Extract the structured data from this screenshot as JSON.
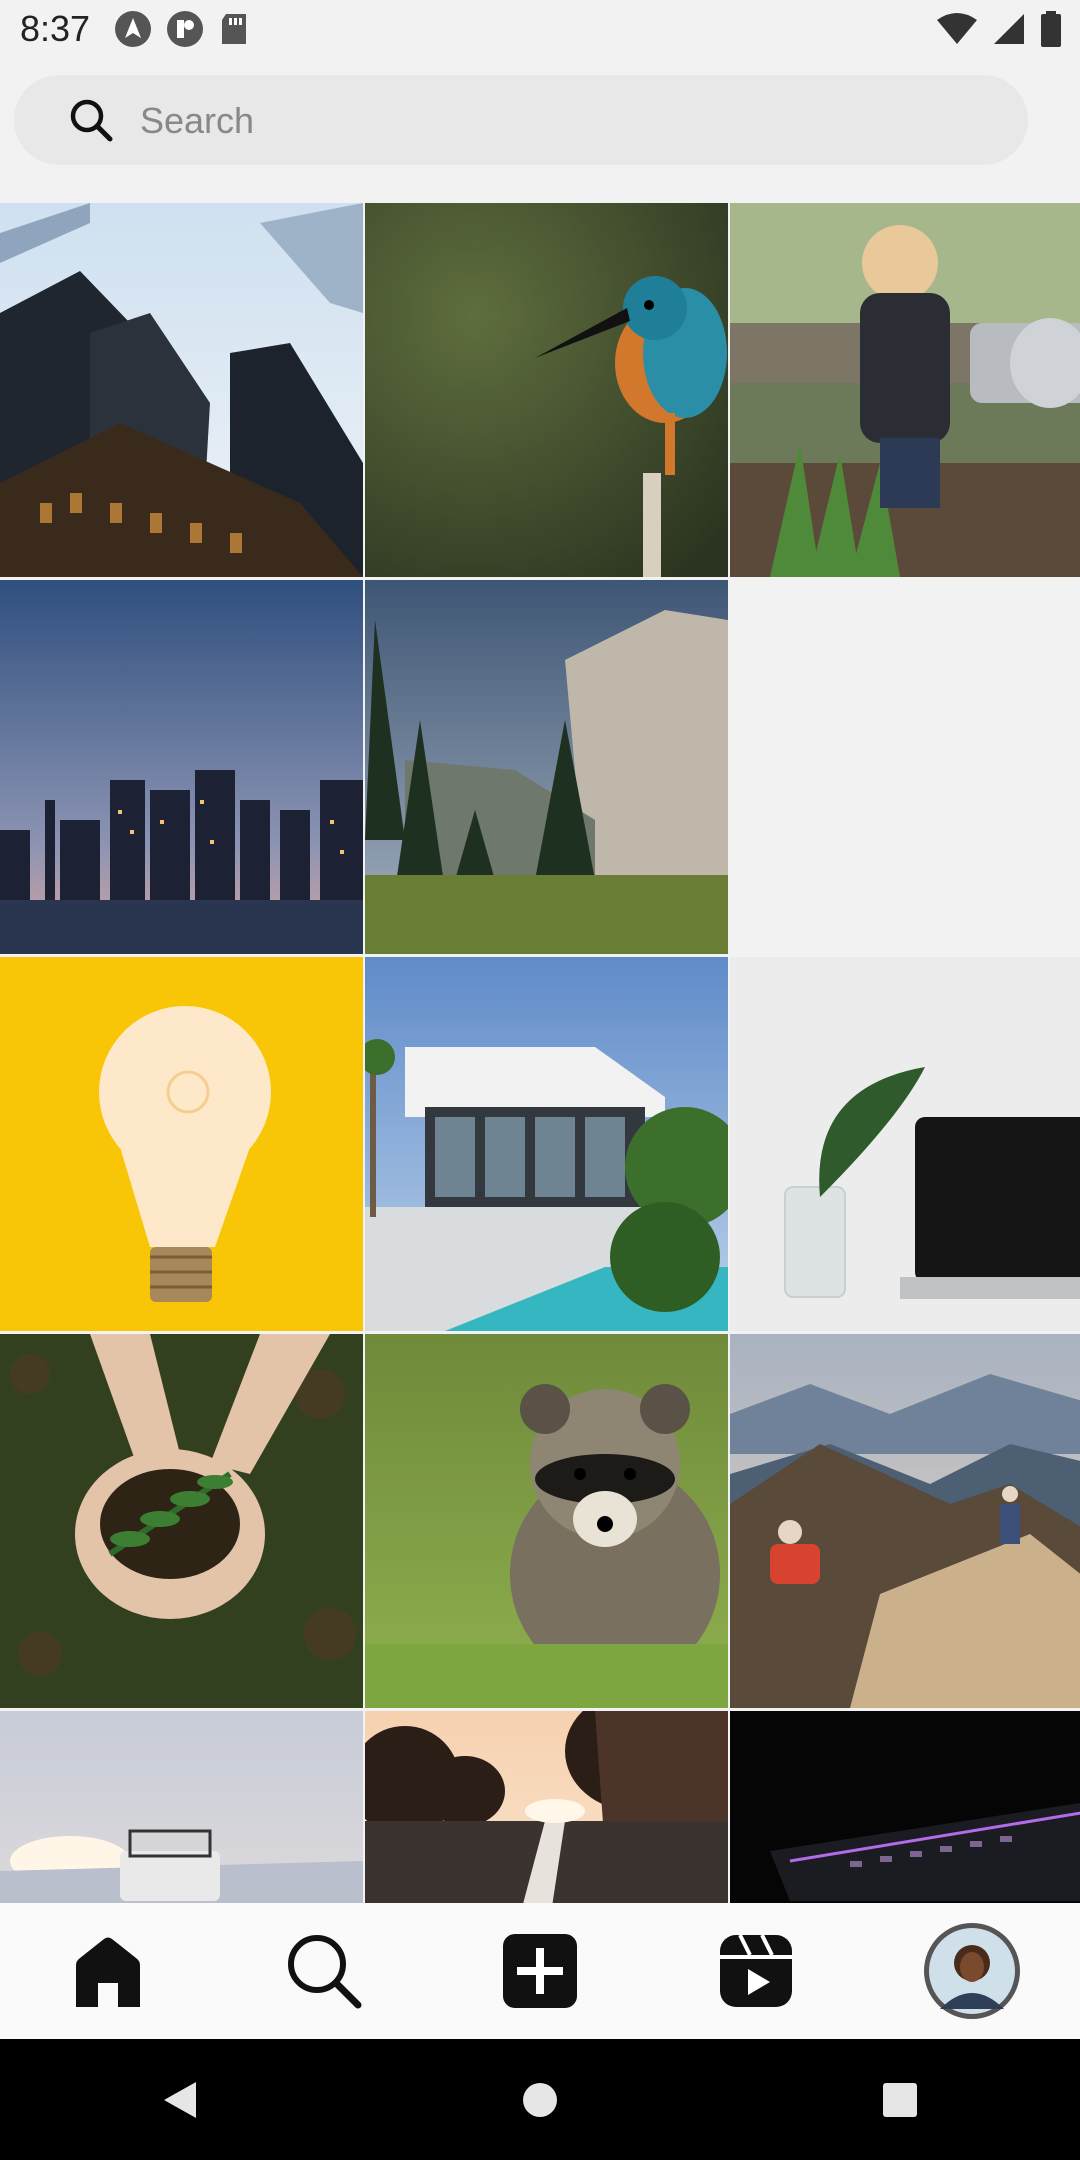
{
  "status_bar": {
    "time": "8:37",
    "left_icons": [
      "navigation-arrow-icon",
      "app-notification-icon",
      "sd-card-icon"
    ],
    "right_icons": [
      "wifi-icon",
      "cell-signal-icon",
      "battery-icon"
    ]
  },
  "search": {
    "placeholder": "Search",
    "value": ""
  },
  "grid": {
    "tiles": [
      {
        "subject": "skyscrapers"
      },
      {
        "subject": "kingfisher"
      },
      {
        "subject": "child-watering-garden"
      },
      {
        "subject": "city-skyline-dusk"
      },
      {
        "subject": "mountain-cliff-forest"
      },
      {
        "subject": "lightbulb-yellow"
      },
      {
        "subject": "modern-house-pool"
      },
      {
        "subject": "laptop-plant"
      },
      {
        "subject": "hands-soil-seedling"
      },
      {
        "subject": "raccoon-grass"
      },
      {
        "subject": "mountain-hikers"
      },
      {
        "subject": "jeep-sunrise"
      },
      {
        "subject": "road-sunset"
      },
      {
        "subject": "laptop-keyboard-dark"
      }
    ]
  },
  "bottom_nav": {
    "items": [
      "home-icon",
      "search-icon",
      "create-post-icon",
      "reels-icon",
      "profile-avatar"
    ],
    "active": "home-icon"
  },
  "system_nav": {
    "items": [
      "back-icon",
      "home-circle-icon",
      "recents-icon"
    ]
  }
}
